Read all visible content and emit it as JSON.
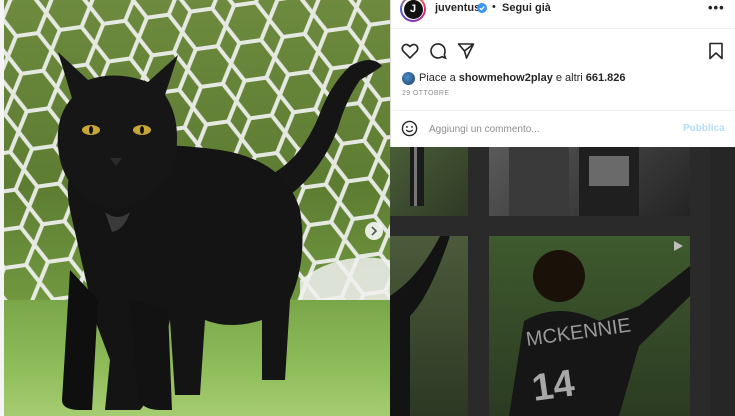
{
  "post": {
    "image_icon": "black-cat-photo",
    "next_icon": "chevron-right-icon"
  },
  "header": {
    "username": "juventus",
    "verified_icon": "verified-badge-icon",
    "separator": "•",
    "follow_label": "Segui già",
    "more_label": "•••"
  },
  "actions": {
    "like_icon": "heart-icon",
    "comment_icon": "comment-icon",
    "share_icon": "share-icon",
    "save_icon": "bookmark-icon"
  },
  "likes": {
    "prefix": "Piace a",
    "user": "showmehow2play",
    "connector": "e altri",
    "count": "661.826"
  },
  "date": "29 OTTOBRE",
  "comment": {
    "emoji_icon": "smiley-icon",
    "placeholder": "Aggiungi un commento...",
    "publish_label": "Pubblica"
  },
  "colors": {
    "accent": "#0095f6",
    "publish_disabled": "#b2dffc",
    "text": "#262626",
    "muted": "#8e8e8e"
  }
}
